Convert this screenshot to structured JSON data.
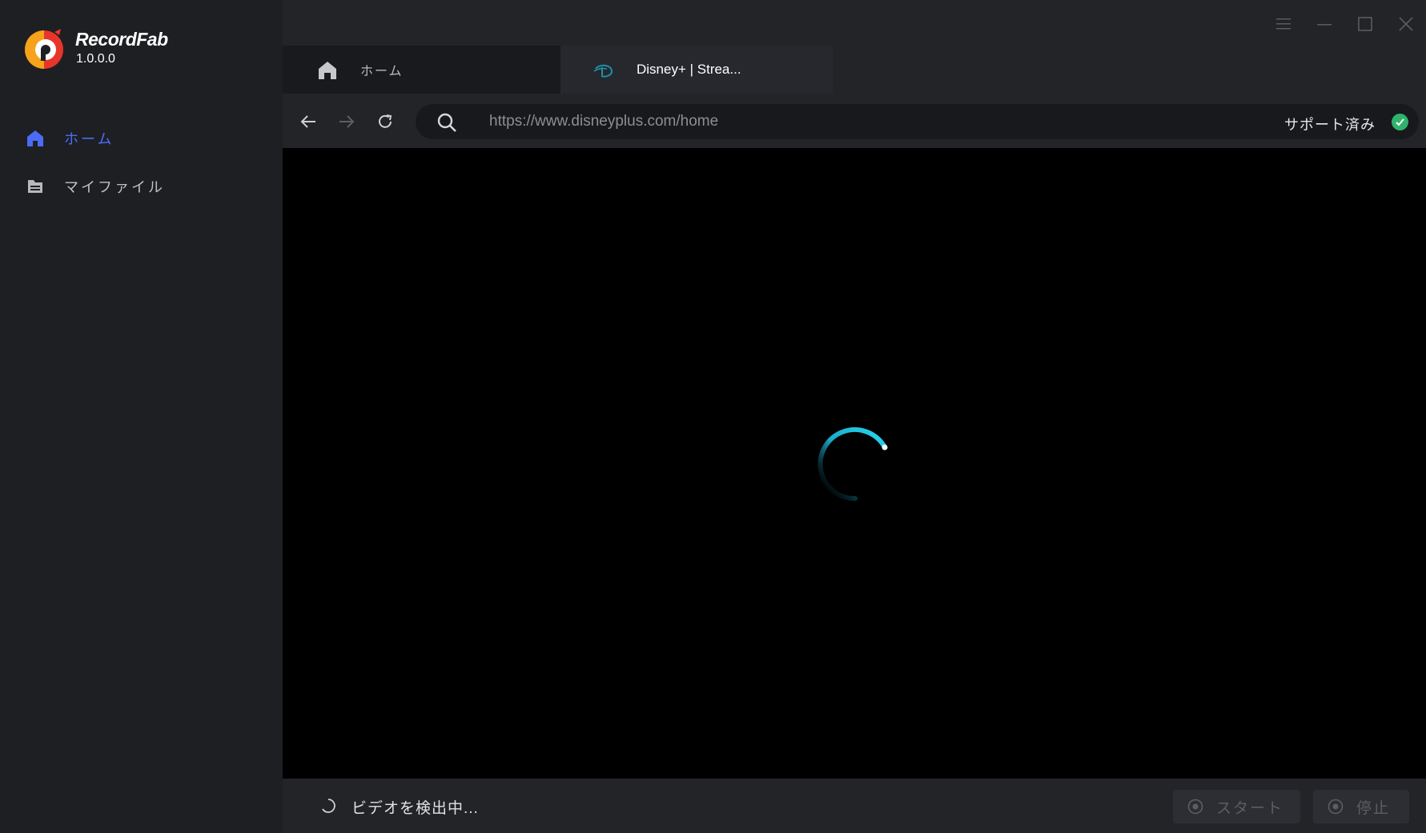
{
  "app": {
    "name": "RecordFab",
    "version": "1.0.0.0"
  },
  "sidebar": {
    "items": [
      {
        "label": "ホーム",
        "icon": "home-icon",
        "active": true
      },
      {
        "label": "マイファイル",
        "icon": "folder-icon",
        "active": false
      }
    ]
  },
  "tabs": [
    {
      "label": "ホーム",
      "icon": "home-icon"
    },
    {
      "label": "Disney+ | Strea...",
      "icon": "disney-icon"
    }
  ],
  "address": {
    "url": "https://www.disneyplus.com/home",
    "support_label": "サポート済み"
  },
  "status": {
    "detecting_text": "ビデオを検出中..."
  },
  "actions": {
    "start_label": "スタート",
    "stop_label": "停止"
  },
  "colors": {
    "accent": "#4a6cf7",
    "support_green": "#2fb36c",
    "spinner": "#1ec8e0"
  }
}
